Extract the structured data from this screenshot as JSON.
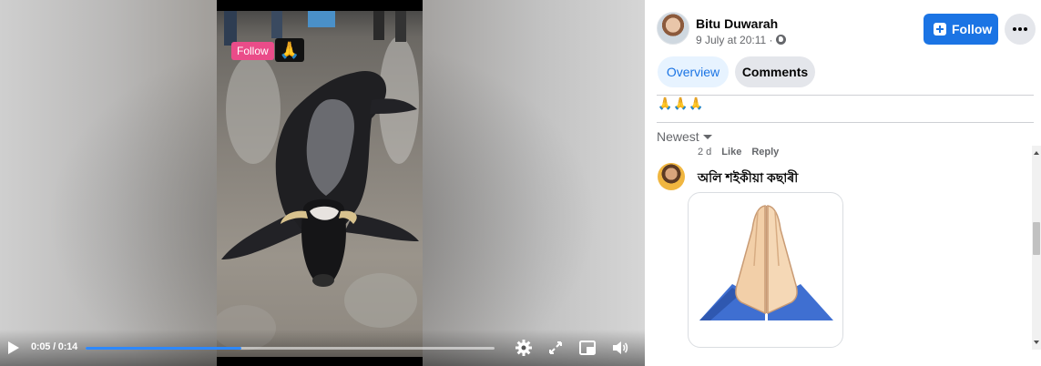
{
  "video": {
    "follow_badge": "Follow",
    "pray_badge": "🙏",
    "time_display": "0:05 / 0:14",
    "progress_fraction": 0.38,
    "icons": [
      "play-icon",
      "gear-icon",
      "expand-icon",
      "picture-in-picture-icon",
      "volume-icon"
    ]
  },
  "post": {
    "author": "Bitu Duwarah",
    "time": "9 July at 20:11 ·",
    "follow_label": "Follow",
    "more_label": "···"
  },
  "tabs": {
    "overview": "Overview",
    "comments": "Comments"
  },
  "caption": "🙏🙏🙏",
  "comments_section": {
    "sort_label": "Newest",
    "previous_meta": {
      "age": "2 d",
      "like": "Like",
      "reply": "Reply"
    },
    "comment": {
      "author": "অলি শইকীয়া কছাৰী",
      "sticker": "folded-hands-sticker"
    }
  },
  "colors": {
    "accent": "#1b74e4",
    "progress": "#2d88ff",
    "follow_badge": "#ea4c89"
  }
}
